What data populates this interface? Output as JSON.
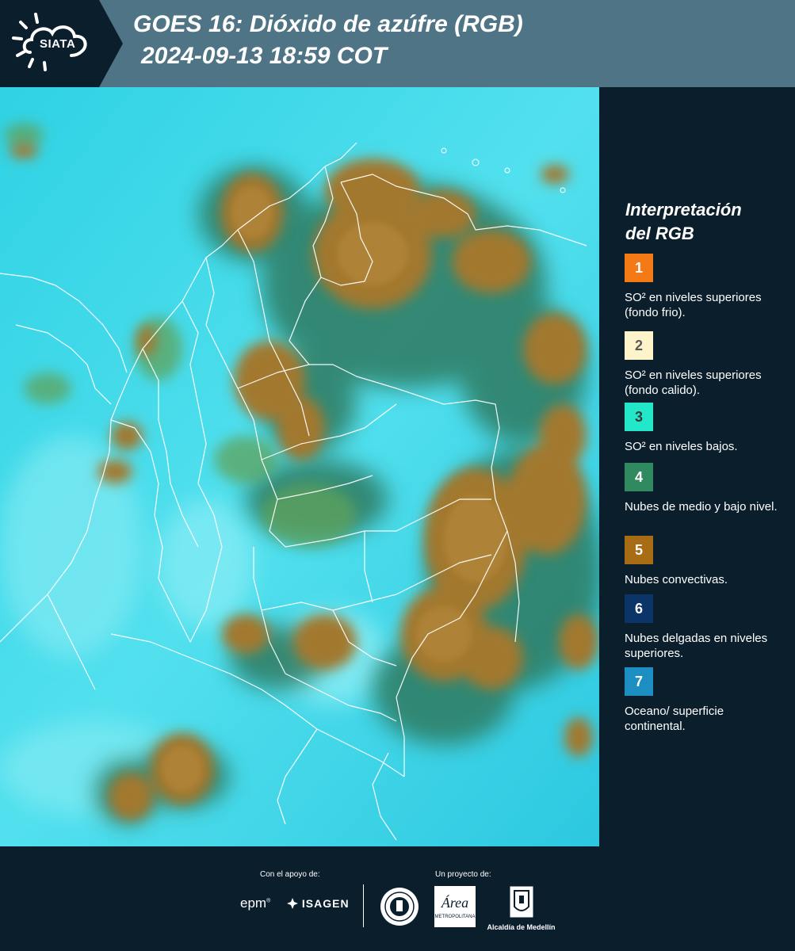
{
  "header": {
    "logo_text": "SIATA",
    "title_line1": "GOES 16: Dióxido de azúfre (RGB)",
    "title_line2": "2024-09-13 18:59 COT"
  },
  "legend": {
    "title_line1": "Interpretación",
    "title_line2": "del RGB",
    "items": [
      {
        "number": "1",
        "color": "#f47a16",
        "text_color": "#ffffff",
        "label": "SO² en niveles superiores (fondo frio)."
      },
      {
        "number": "2",
        "color": "#fdf5c9",
        "text_color": "#5a5a5a",
        "label": "SO² en niveles superiores (fondo calido)."
      },
      {
        "number": "3",
        "color": "#22e8c9",
        "text_color": "#3a3a3a",
        "label": "SO² en niveles bajos."
      },
      {
        "number": "4",
        "color": "#2f8a5f",
        "text_color": "#ffffff",
        "label": "Nubes de medio y bajo nivel."
      },
      {
        "number": "5",
        "color": "#a76c14",
        "text_color": "#ffffff",
        "label": "Nubes convectivas."
      },
      {
        "number": "6",
        "color": "#0b3468",
        "text_color": "#ffffff",
        "label": "Nubes delgadas en niveles superiores."
      },
      {
        "number": "7",
        "color": "#1d8ec2",
        "text_color": "#ffffff",
        "label": "Oceano/ superficie continental."
      }
    ]
  },
  "footer": {
    "support_caption": "Con el apoyo de:",
    "project_caption": "Un proyecto de:",
    "epm_logo": "epm",
    "isagen_logo": "ISAGEN",
    "area_logo_text": "Área",
    "area_logo_sub": "METROPOLITANA",
    "alcaldia_text": "Alcaldía de Medellín"
  },
  "colors": {
    "header_bg": "#4f7486",
    "logo_bg": "#0b1e2c",
    "panel_bg": "#0b1e2c",
    "ocean_cyan": "#35d6e6",
    "convective_brown": "#a2782d",
    "mid_low_green": "#3f8a6a",
    "borders": "#ffffff"
  }
}
